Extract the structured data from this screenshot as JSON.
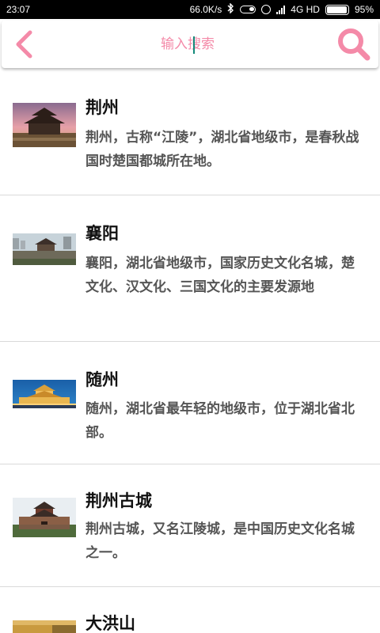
{
  "status_bar": {
    "time": "23:07",
    "network_speed": "66.0K/s",
    "network_type": "4G HD",
    "battery": "95%",
    "battery_level": 0.95,
    "icons": [
      "bluetooth-icon",
      "toggle-icon",
      "alarm-icon",
      "signal-icon",
      "battery-icon"
    ]
  },
  "header": {
    "back_icon": "chevron-left-icon",
    "search_placeholder": "输入搜索",
    "search_icon": "search-icon",
    "accent_color": "#f48aa8"
  },
  "list": {
    "items": [
      {
        "title": "荆州",
        "description": "荆州，古称“江陵”，湖北省地级市，是春秋战国时楚国都城所在地。",
        "image": "jingzhou-city-gate-photo"
      },
      {
        "title": "襄阳",
        "description": "襄阳，湖北省地级市，国家历史文化名城，楚文化、汉文化、三国文化的主要发源地",
        "image": "xiangyang-city-wall-photo"
      },
      {
        "title": "随州",
        "description": "随州，湖北省最年轻的地级市，位于湖北省北部。",
        "image": "suizhou-night-building-photo"
      },
      {
        "title": "荆州古城",
        "description": "荆州古城，又名江陵城，是中国历史文化名城之一。",
        "image": "jingzhou-ancient-city-photo"
      },
      {
        "title": "大洪山",
        "description": "",
        "image": "dahongshan-photo"
      }
    ]
  }
}
